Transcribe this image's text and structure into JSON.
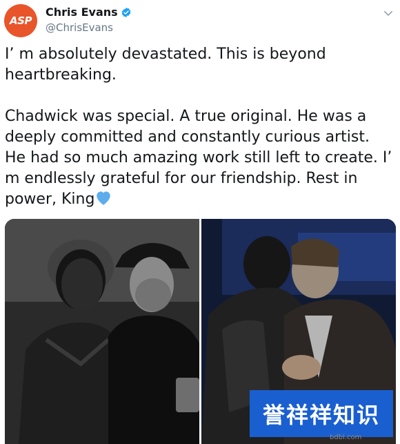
{
  "author": {
    "avatar_text": "ASP",
    "display_name": "Chris Evans",
    "handle": "@ChrisEvans"
  },
  "tweet": {
    "paragraph_1": "I’  m absolutely devastated. This is beyond heartbreaking.",
    "paragraph_2": "Chadwick was special. A true original. He was a deeply committed and constantly curious artist. He had so much amazing work still left to create. I’  m endlessly grateful for our friendship. Rest in power, King"
  },
  "watermark": {
    "text": "誉祥祥知识"
  },
  "corner_mark": "bdbl.com",
  "colors": {
    "avatar": "#e8552b",
    "verified": "#1da1f2",
    "heart": "#5dadec",
    "watermark_bg": "#1a5fd0"
  }
}
